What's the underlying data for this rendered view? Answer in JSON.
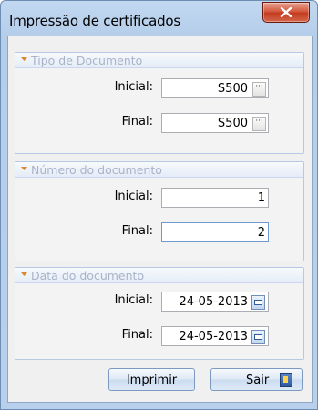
{
  "window": {
    "title": "Impressão de certificados"
  },
  "groups": {
    "tipo": {
      "title": "Tipo de Documento",
      "inicial_label": "Inicial:",
      "inicial_value": "S500",
      "final_label": "Final:",
      "final_value": "S500"
    },
    "numero": {
      "title": "Número do documento",
      "inicial_label": "Inicial:",
      "inicial_value": "1",
      "final_label": "Final:",
      "final_value": "2"
    },
    "data": {
      "title": "Data do documento",
      "inicial_label": "Inicial:",
      "inicial_value": "24-05-2013",
      "final_label": "Final:",
      "final_value": "24-05-2013"
    }
  },
  "buttons": {
    "print_label": "Imprimir",
    "exit_label": "Sair"
  },
  "icons": {
    "close": "close-icon",
    "browse": "ellipsis-icon",
    "calendar": "calendar-icon",
    "exit": "exit-door-icon",
    "group": "chevron-icon"
  },
  "colors": {
    "title_bar": "#b9d1ea",
    "close_button": "#c94a2e",
    "group_title": "#a9b3c9",
    "dialog_bg": "#f0f0f0"
  }
}
